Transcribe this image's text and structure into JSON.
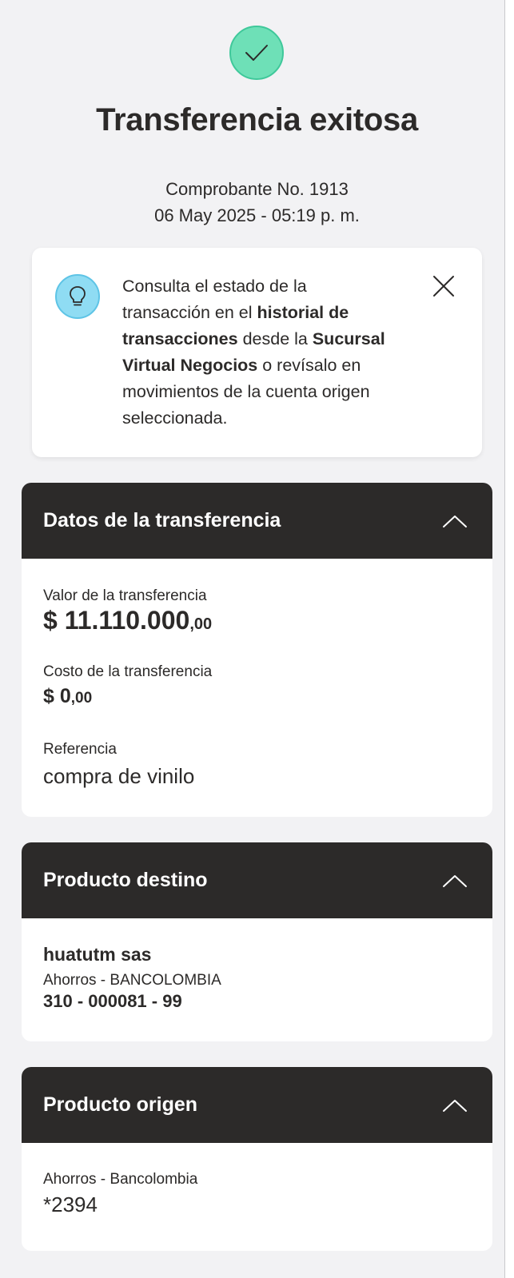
{
  "header": {
    "success_icon": "check-icon",
    "title": "Transferencia exitosa",
    "voucher_line": "Comprobante No. 1913",
    "date_line": "06 May 2025 - 05:19 p. m."
  },
  "info_card": {
    "icon": "lightbulb-icon",
    "text_1": "Consulta el estado de la transacción en el ",
    "text_bold_1": "historial de transacciones",
    "text_2": " desde la ",
    "text_bold_2": "Sucursal Virtual Negocios",
    "text_3": " o revísalo en movimientos de la cuenta origen seleccionada.",
    "close_icon": "close-icon"
  },
  "transfer_data": {
    "title": "Datos de la transferencia",
    "amount_label": "Valor de la transferencia",
    "amount_main": "$ 11.110.000",
    "amount_cents": ",00",
    "cost_label": "Costo de la transferencia",
    "cost_main": "$ 0",
    "cost_cents": ",00",
    "reference_label": "Referencia",
    "reference_value": "compra de vinilo"
  },
  "destination": {
    "title": "Producto destino",
    "name": "huatutm sas",
    "account_type": "Ahorros - BANCOLOMBIA",
    "account_number": "310 - 000081 - 99"
  },
  "origin": {
    "title": "Producto origen",
    "account_type": "Ahorros - Bancolombia",
    "account_number": "*2394"
  },
  "colors": {
    "background": "#f2f2f4",
    "header_dark": "#2c2a29",
    "success_green": "#6ee0b7",
    "info_blue": "#8fdcf3"
  }
}
